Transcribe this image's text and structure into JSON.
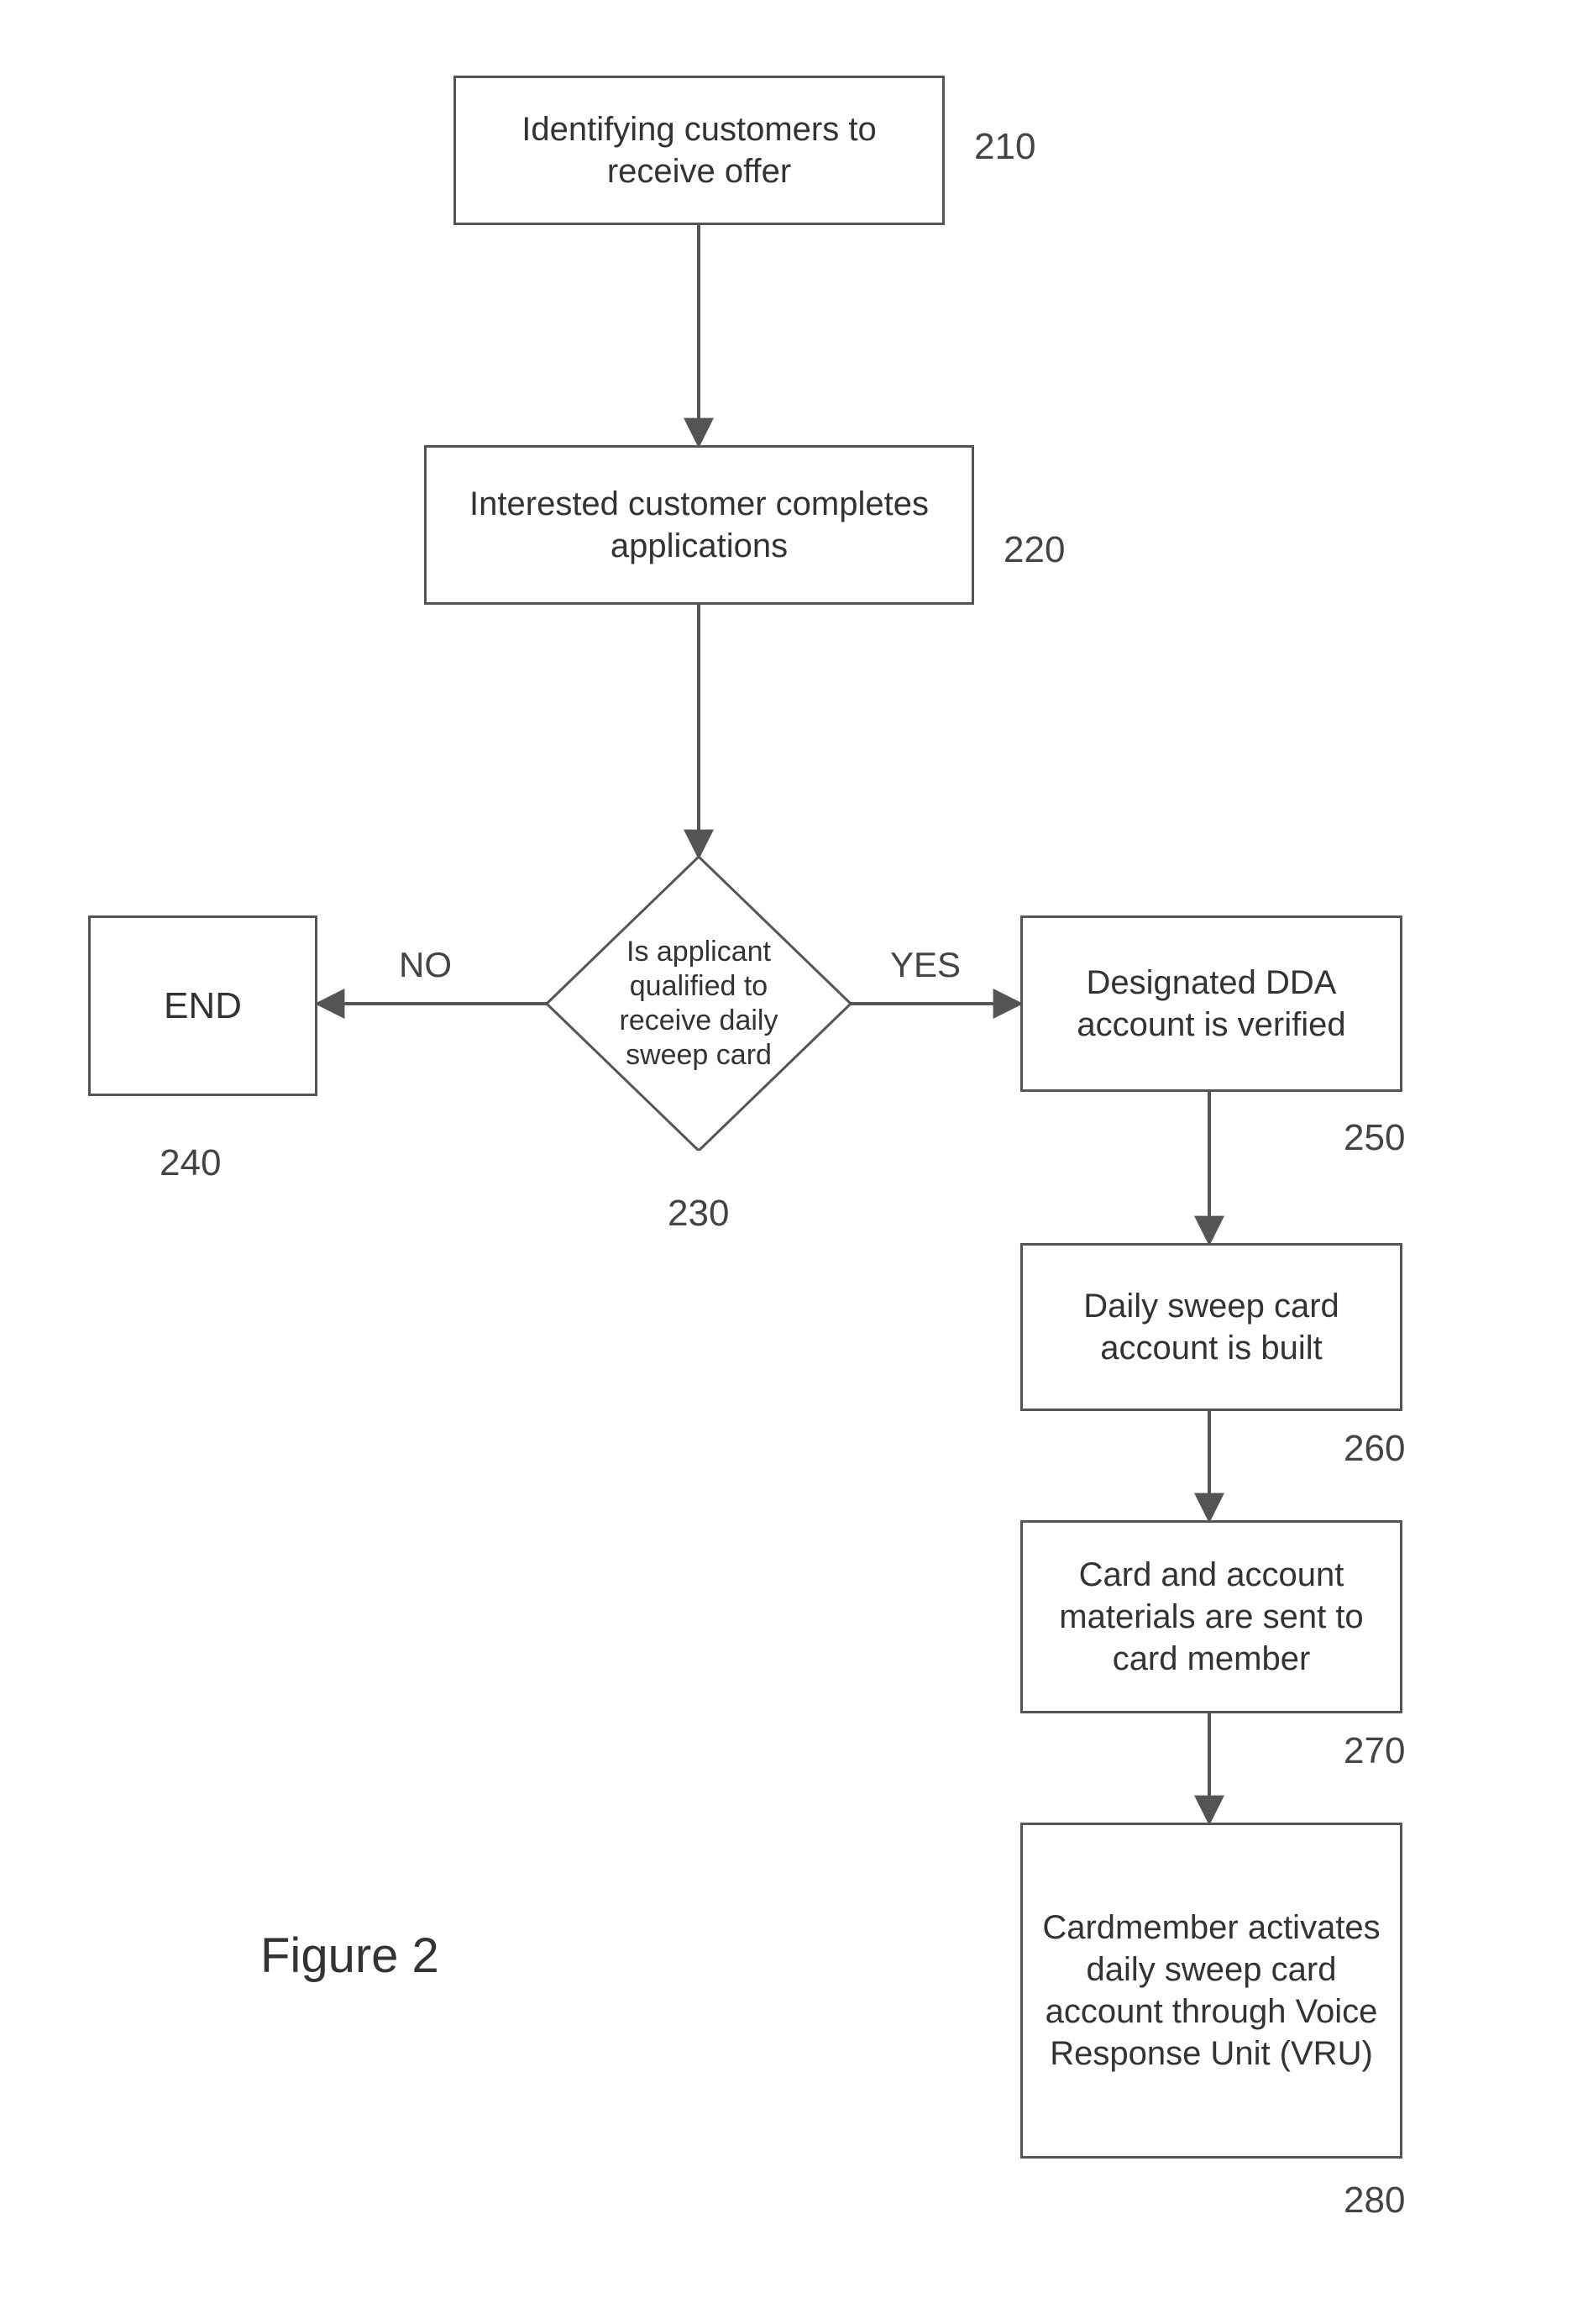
{
  "figure_caption": "Figure 2",
  "nodes": {
    "n210": {
      "label": "Identifying customers to receive offer",
      "ref": "210"
    },
    "n220": {
      "label": "Interested customer completes applications",
      "ref": "220"
    },
    "n230": {
      "label": "Is applicant qualified to receive daily sweep card",
      "ref": "230"
    },
    "n240": {
      "label": "END",
      "ref": "240"
    },
    "n250": {
      "label": "Designated DDA account  is verified",
      "ref": "250"
    },
    "n260": {
      "label": "Daily sweep card account is built",
      "ref": "260"
    },
    "n270": {
      "label": "Card and account materials are sent to card member",
      "ref": "270"
    },
    "n280": {
      "label": "Cardmember activates daily sweep card account through Voice Response Unit (VRU)",
      "ref": "280"
    }
  },
  "edges": {
    "no": "NO",
    "yes": "YES"
  }
}
